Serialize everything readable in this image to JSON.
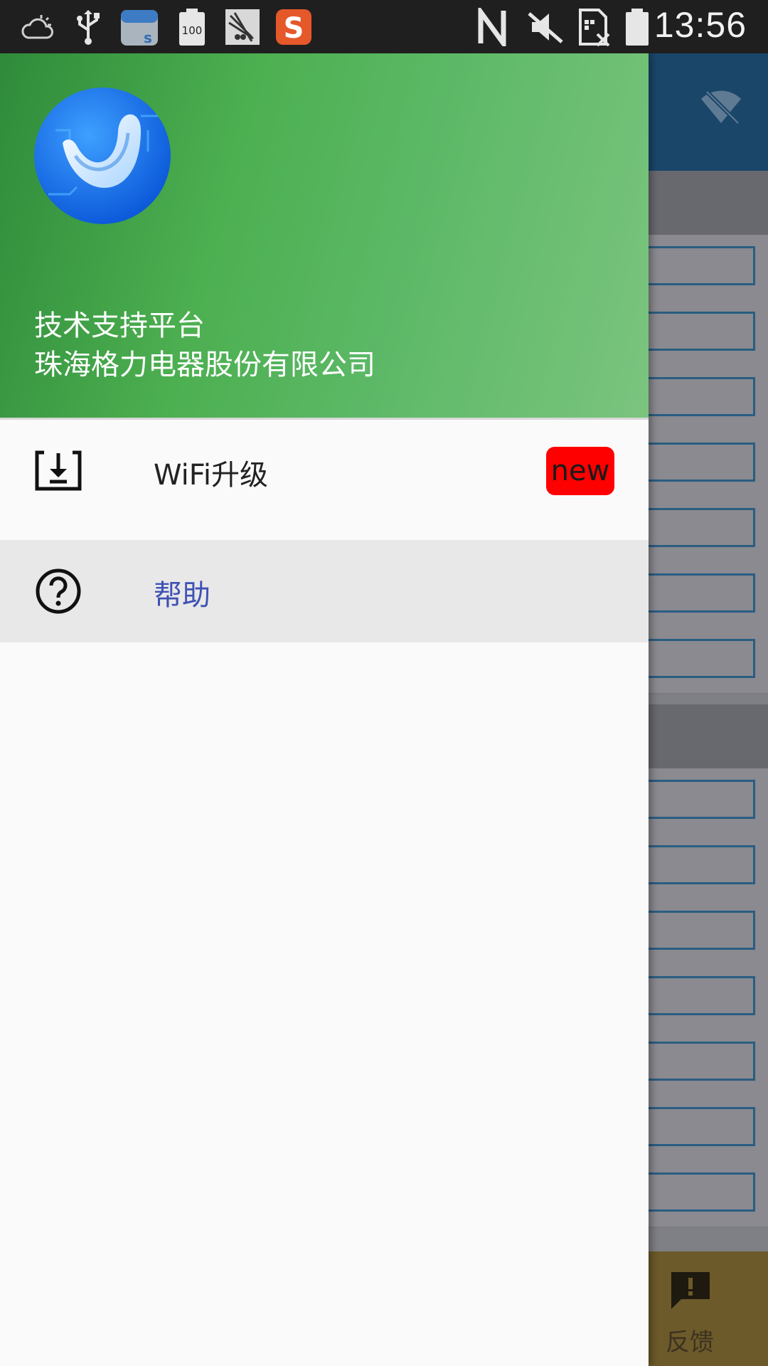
{
  "status_bar": {
    "time": "13:56",
    "battery_text": "100",
    "icons": [
      "weather-cloud-icon",
      "usb-icon",
      "store-bag-icon",
      "battery-100-icon",
      "satellite-icon",
      "sogou-icon",
      "nfc-icon",
      "mute-icon",
      "no-sim-icon",
      "battery-icon"
    ]
  },
  "drawer": {
    "header": {
      "title": "技术支持平台",
      "subtitle": "珠海格力电器股份有限公司"
    },
    "menu": [
      {
        "label": "WiFi升级",
        "icon": "download-icon",
        "badge": "new",
        "selected": false
      },
      {
        "label": "帮助",
        "icon": "help-circle-icon",
        "selected": true
      }
    ]
  },
  "background_app": {
    "feedback_label": "反馈",
    "feedback_icon": "feedback-alert-icon",
    "header_icon": "wifi-off-icon"
  },
  "colors": {
    "status_bar": "#1f1f1f",
    "header_green": "#4caf50",
    "badge_red": "#ff0000",
    "selected_text": "#3f51b5",
    "selected_bg": "#e8e8e8"
  }
}
